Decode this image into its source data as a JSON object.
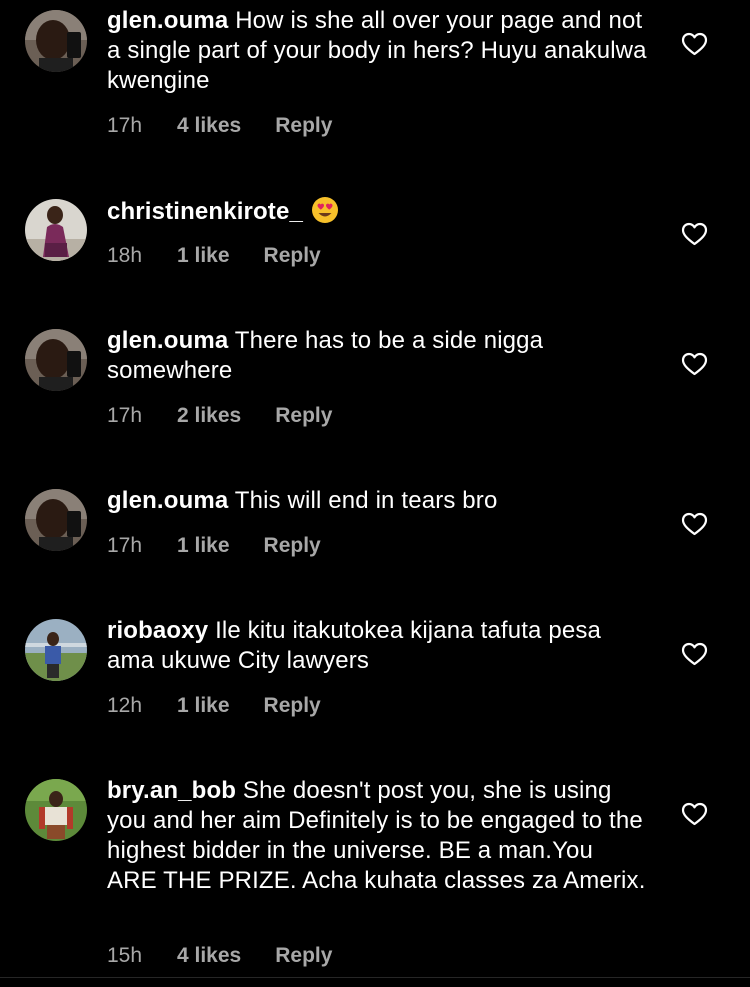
{
  "comments": [
    {
      "username": "glen.ouma",
      "text": "How is she all over your page and not a single part of your body in hers? Huyu anakulwa kwengine",
      "time": "17h",
      "likes": "4 likes",
      "reply": "Reply",
      "avatar": "glen-ouma-avatar"
    },
    {
      "username": "christinenkirote_",
      "text": "",
      "emoji": "heart-eyes-emoji",
      "time": "18h",
      "likes": "1 like",
      "reply": "Reply",
      "avatar": "christinenkirote-avatar"
    },
    {
      "username": "glen.ouma",
      "text": "There has to be a side nigga somewhere",
      "time": "17h",
      "likes": "2 likes",
      "reply": "Reply",
      "avatar": "glen-ouma-avatar"
    },
    {
      "username": "glen.ouma",
      "text": "This will end in tears bro",
      "time": "17h",
      "likes": "1 like",
      "reply": "Reply",
      "avatar": "glen-ouma-avatar"
    },
    {
      "username": "riobaoxy",
      "text": "Ile kitu itakutokea kijana tafuta pesa ama ukuwe City lawyers",
      "time": "12h",
      "likes": "1 like",
      "reply": "Reply",
      "avatar": "riobaoxy-avatar"
    },
    {
      "username": "bry.an_bob",
      "text": "She doesn't post you, she is using you and her aim Definitely is to be engaged to the highest bidder in the universe. BE a man.You ARE THE PRIZE. Acha kuhata classes za Amerix.",
      "time": "15h",
      "likes": "4 likes",
      "reply": "Reply",
      "avatar": "bry-an-bob-avatar"
    }
  ],
  "colors": {
    "background": "#000000",
    "text": "#ffffff",
    "meta": "#a8a8a8"
  }
}
